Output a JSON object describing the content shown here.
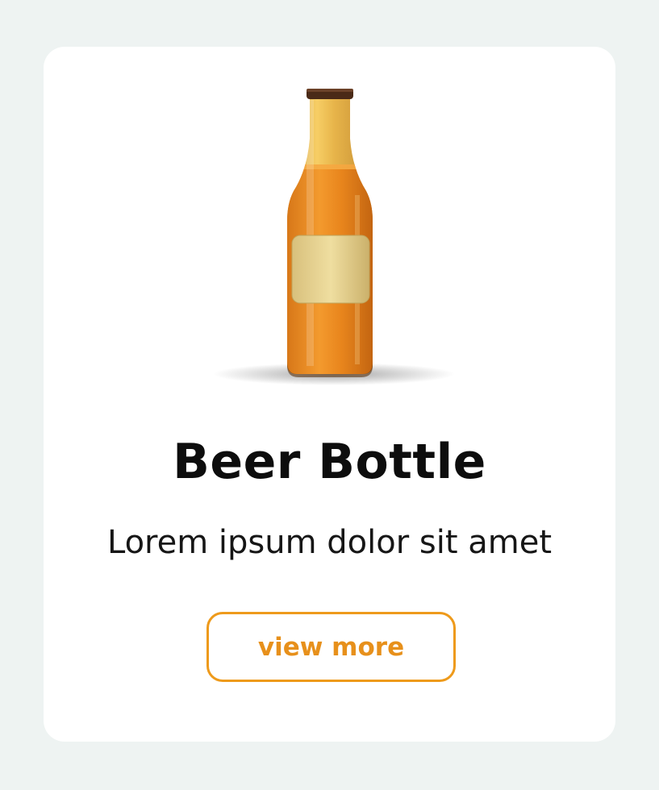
{
  "product_card": {
    "image_icon": "beer-bottle-icon",
    "title": "Beer Bottle",
    "description": "Lorem ipsum dolor sit amet",
    "button_label": "view more"
  },
  "colors": {
    "page_background": "#eef3f2",
    "card_background": "#ffffff",
    "accent": "#ee9a1b",
    "title_text": "#0d0d0d",
    "body_text": "#161616"
  }
}
